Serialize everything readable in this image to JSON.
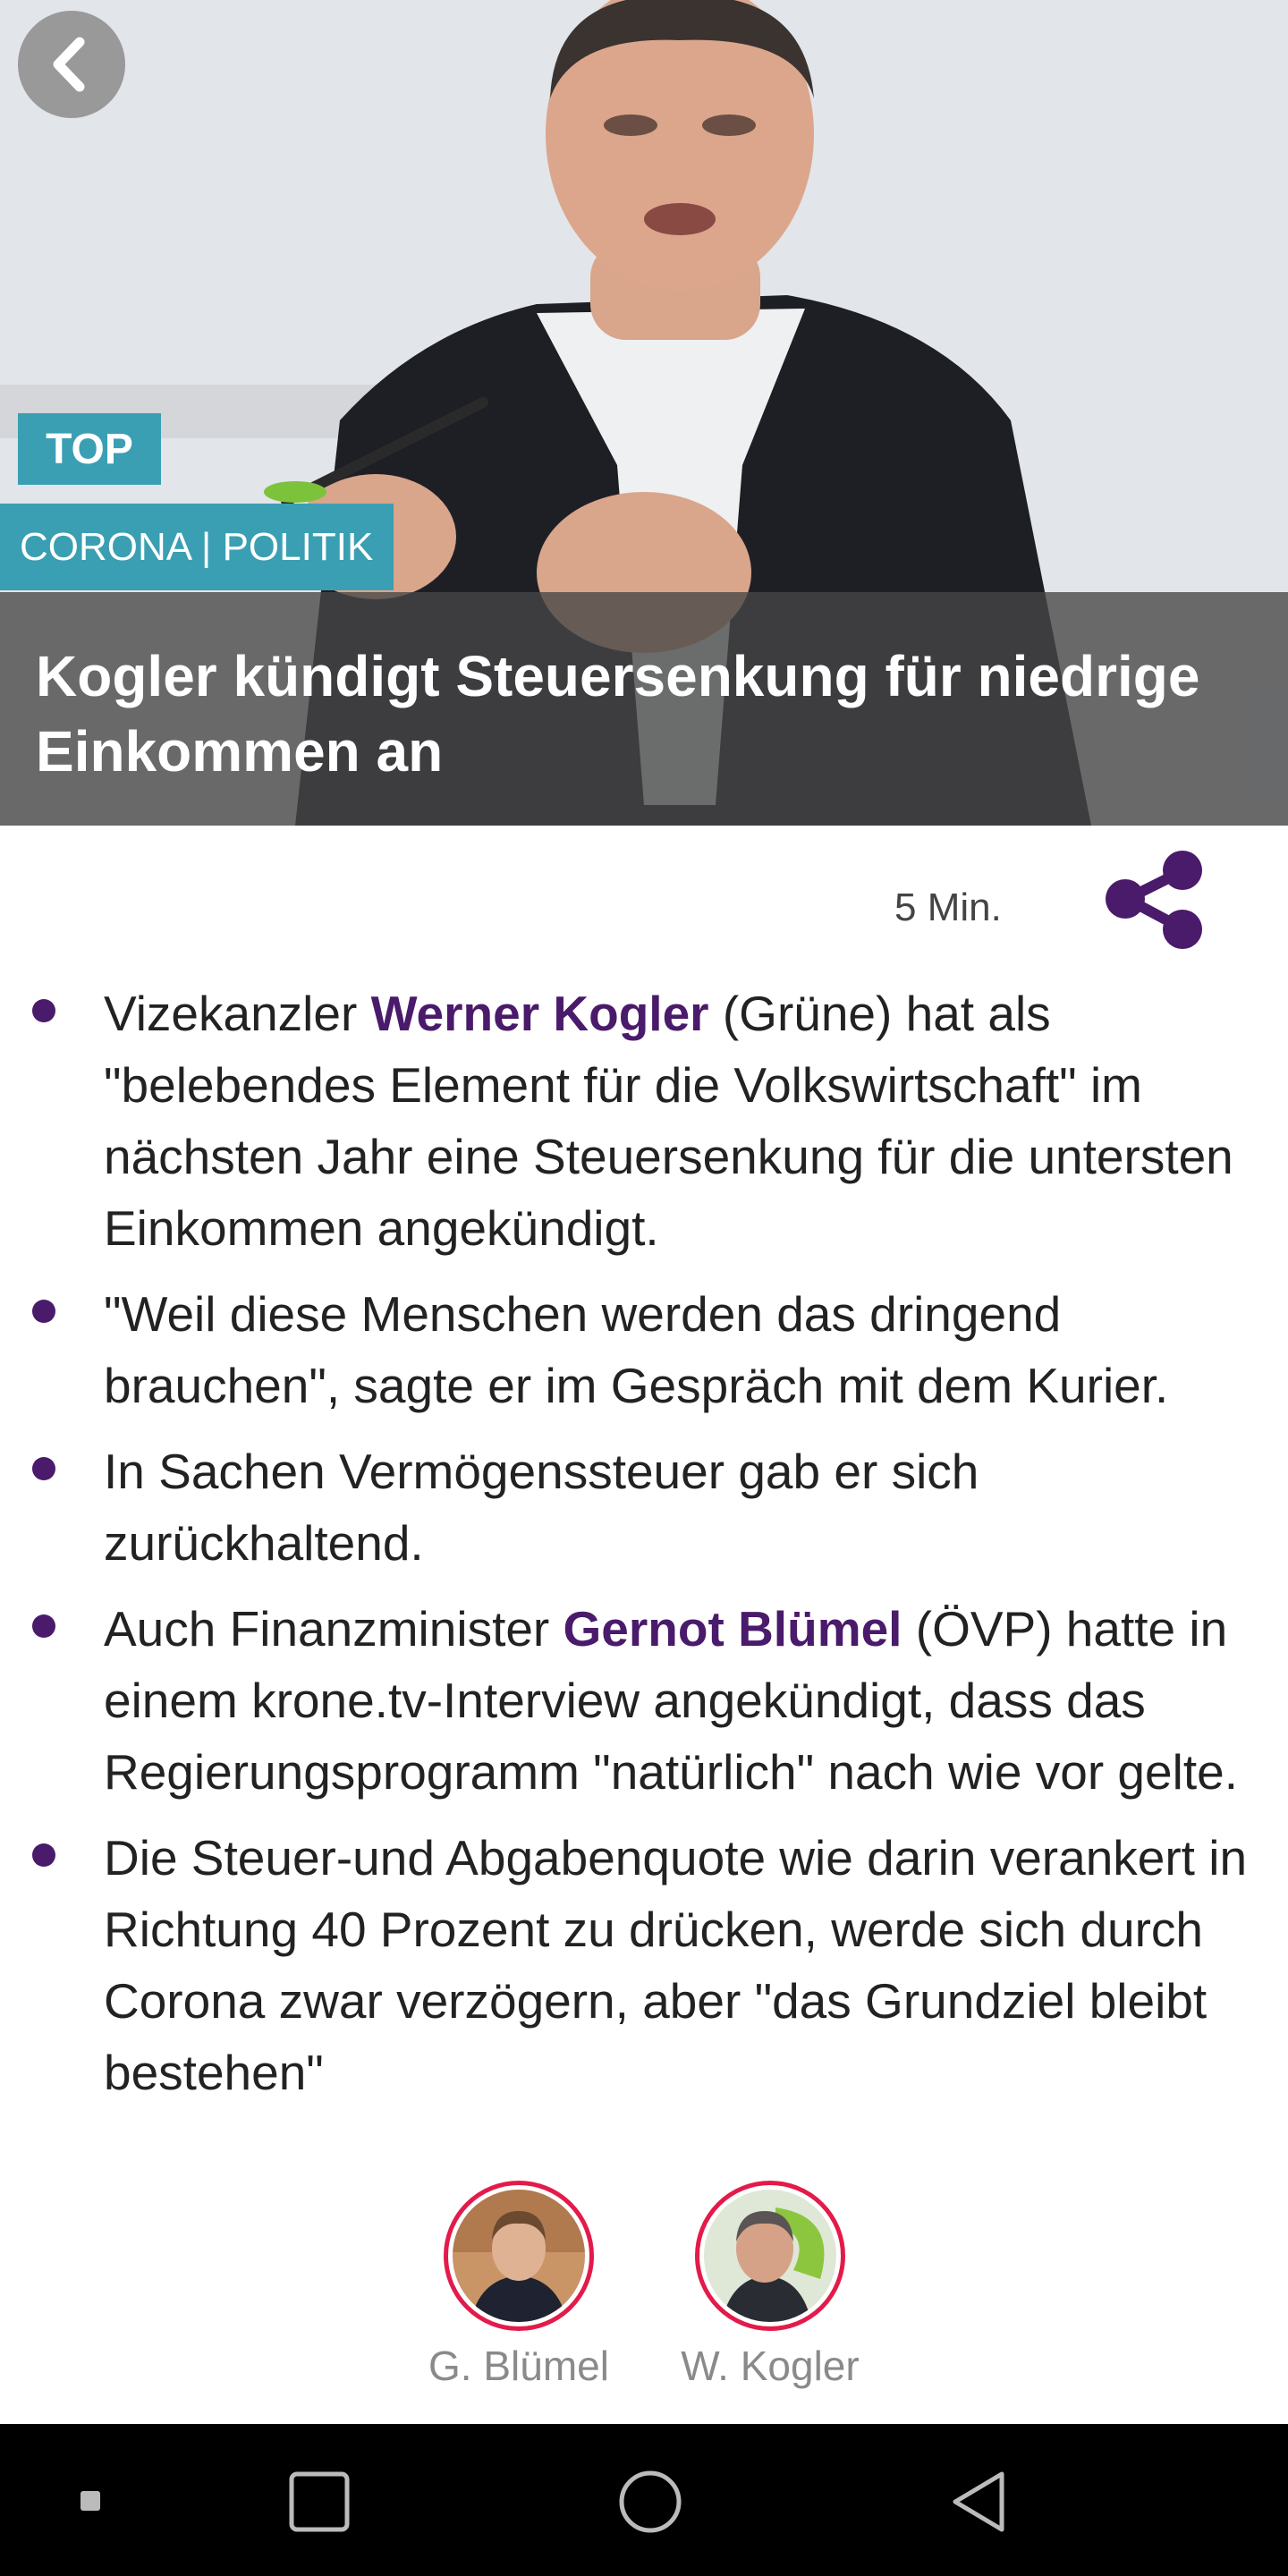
{
  "hero": {
    "badge": "TOP",
    "category": "CORONA | POLITIK",
    "title": "Kogler kündigt Steuersenkung für niedrige Einkommen an"
  },
  "meta": {
    "read_time": "5 Min."
  },
  "bullets": [
    {
      "pre": "Vizekanzler ",
      "name": "Werner Kogler",
      "post": " (Grüne) hat als \"belebendes Element für die Volkswirtschaft\" im nächsten Jahr eine Steuersenkung für die untersten Einkommen angekündigt."
    },
    {
      "pre": "\"Weil diese Menschen werden das dringend brauchen\", sagte er im Gespräch mit dem Kurier.",
      "name": "",
      "post": ""
    },
    {
      "pre": "In Sachen Vermögenssteuer gab er sich zurückhaltend.",
      "name": "",
      "post": ""
    },
    {
      "pre": "Auch Finanzminister ",
      "name": "Gernot Blümel",
      "post": " (ÖVP) hatte in einem krone.tv-Interview angekündigt, dass das Regierungsprogramm \"natürlich\" nach wie vor gelte."
    },
    {
      "pre": "Die Steuer-und Abgabenquote wie darin verankert in Richtung 40 Prozent zu drücken, werde sich durch Corona zwar verzögern, aber \"das Grundziel bleibt bestehen\"",
      "name": "",
      "post": ""
    }
  ],
  "people": [
    {
      "name": "G. Blümel"
    },
    {
      "name": "W. Kogler"
    }
  ],
  "colors": {
    "accent_purple": "#4a1a6b",
    "badge_teal": "#3a9fb3",
    "avatar_ring": "#e31b4a"
  },
  "icons": {
    "back": "chevron-left-icon",
    "share": "share-icon",
    "nav": [
      "recent-dot-icon",
      "square-icon",
      "circle-home-icon",
      "triangle-back-icon"
    ]
  }
}
